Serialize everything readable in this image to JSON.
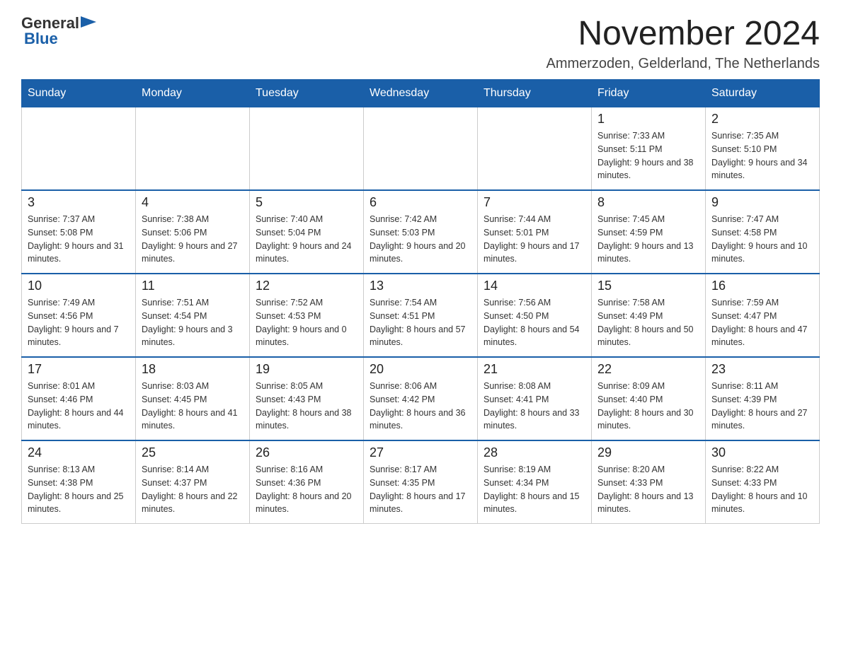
{
  "logo": {
    "general": "General",
    "triangle": "▶",
    "blue": "Blue"
  },
  "title": "November 2024",
  "location": "Ammerzoden, Gelderland, The Netherlands",
  "headers": [
    "Sunday",
    "Monday",
    "Tuesday",
    "Wednesday",
    "Thursday",
    "Friday",
    "Saturday"
  ],
  "weeks": [
    [
      {
        "day": "",
        "info": ""
      },
      {
        "day": "",
        "info": ""
      },
      {
        "day": "",
        "info": ""
      },
      {
        "day": "",
        "info": ""
      },
      {
        "day": "",
        "info": ""
      },
      {
        "day": "1",
        "info": "Sunrise: 7:33 AM\nSunset: 5:11 PM\nDaylight: 9 hours and 38 minutes."
      },
      {
        "day": "2",
        "info": "Sunrise: 7:35 AM\nSunset: 5:10 PM\nDaylight: 9 hours and 34 minutes."
      }
    ],
    [
      {
        "day": "3",
        "info": "Sunrise: 7:37 AM\nSunset: 5:08 PM\nDaylight: 9 hours and 31 minutes."
      },
      {
        "day": "4",
        "info": "Sunrise: 7:38 AM\nSunset: 5:06 PM\nDaylight: 9 hours and 27 minutes."
      },
      {
        "day": "5",
        "info": "Sunrise: 7:40 AM\nSunset: 5:04 PM\nDaylight: 9 hours and 24 minutes."
      },
      {
        "day": "6",
        "info": "Sunrise: 7:42 AM\nSunset: 5:03 PM\nDaylight: 9 hours and 20 minutes."
      },
      {
        "day": "7",
        "info": "Sunrise: 7:44 AM\nSunset: 5:01 PM\nDaylight: 9 hours and 17 minutes."
      },
      {
        "day": "8",
        "info": "Sunrise: 7:45 AM\nSunset: 4:59 PM\nDaylight: 9 hours and 13 minutes."
      },
      {
        "day": "9",
        "info": "Sunrise: 7:47 AM\nSunset: 4:58 PM\nDaylight: 9 hours and 10 minutes."
      }
    ],
    [
      {
        "day": "10",
        "info": "Sunrise: 7:49 AM\nSunset: 4:56 PM\nDaylight: 9 hours and 7 minutes."
      },
      {
        "day": "11",
        "info": "Sunrise: 7:51 AM\nSunset: 4:54 PM\nDaylight: 9 hours and 3 minutes."
      },
      {
        "day": "12",
        "info": "Sunrise: 7:52 AM\nSunset: 4:53 PM\nDaylight: 9 hours and 0 minutes."
      },
      {
        "day": "13",
        "info": "Sunrise: 7:54 AM\nSunset: 4:51 PM\nDaylight: 8 hours and 57 minutes."
      },
      {
        "day": "14",
        "info": "Sunrise: 7:56 AM\nSunset: 4:50 PM\nDaylight: 8 hours and 54 minutes."
      },
      {
        "day": "15",
        "info": "Sunrise: 7:58 AM\nSunset: 4:49 PM\nDaylight: 8 hours and 50 minutes."
      },
      {
        "day": "16",
        "info": "Sunrise: 7:59 AM\nSunset: 4:47 PM\nDaylight: 8 hours and 47 minutes."
      }
    ],
    [
      {
        "day": "17",
        "info": "Sunrise: 8:01 AM\nSunset: 4:46 PM\nDaylight: 8 hours and 44 minutes."
      },
      {
        "day": "18",
        "info": "Sunrise: 8:03 AM\nSunset: 4:45 PM\nDaylight: 8 hours and 41 minutes."
      },
      {
        "day": "19",
        "info": "Sunrise: 8:05 AM\nSunset: 4:43 PM\nDaylight: 8 hours and 38 minutes."
      },
      {
        "day": "20",
        "info": "Sunrise: 8:06 AM\nSunset: 4:42 PM\nDaylight: 8 hours and 36 minutes."
      },
      {
        "day": "21",
        "info": "Sunrise: 8:08 AM\nSunset: 4:41 PM\nDaylight: 8 hours and 33 minutes."
      },
      {
        "day": "22",
        "info": "Sunrise: 8:09 AM\nSunset: 4:40 PM\nDaylight: 8 hours and 30 minutes."
      },
      {
        "day": "23",
        "info": "Sunrise: 8:11 AM\nSunset: 4:39 PM\nDaylight: 8 hours and 27 minutes."
      }
    ],
    [
      {
        "day": "24",
        "info": "Sunrise: 8:13 AM\nSunset: 4:38 PM\nDaylight: 8 hours and 25 minutes."
      },
      {
        "day": "25",
        "info": "Sunrise: 8:14 AM\nSunset: 4:37 PM\nDaylight: 8 hours and 22 minutes."
      },
      {
        "day": "26",
        "info": "Sunrise: 8:16 AM\nSunset: 4:36 PM\nDaylight: 8 hours and 20 minutes."
      },
      {
        "day": "27",
        "info": "Sunrise: 8:17 AM\nSunset: 4:35 PM\nDaylight: 8 hours and 17 minutes."
      },
      {
        "day": "28",
        "info": "Sunrise: 8:19 AM\nSunset: 4:34 PM\nDaylight: 8 hours and 15 minutes."
      },
      {
        "day": "29",
        "info": "Sunrise: 8:20 AM\nSunset: 4:33 PM\nDaylight: 8 hours and 13 minutes."
      },
      {
        "day": "30",
        "info": "Sunrise: 8:22 AM\nSunset: 4:33 PM\nDaylight: 8 hours and 10 minutes."
      }
    ]
  ]
}
